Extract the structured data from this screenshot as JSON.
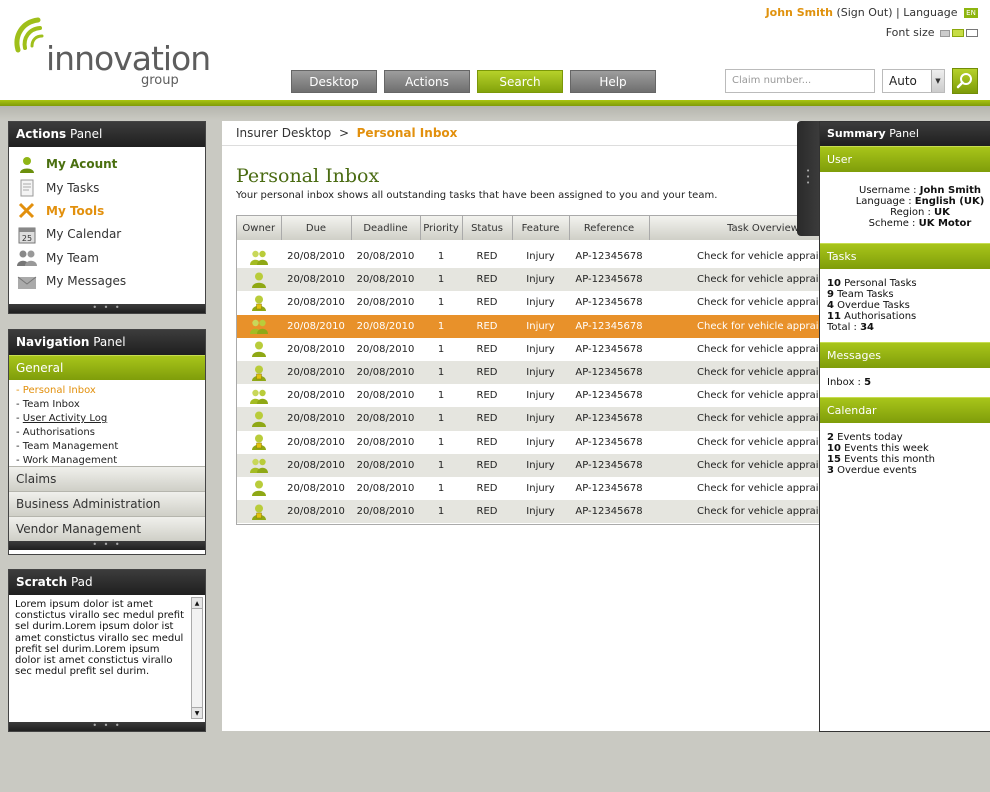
{
  "brand": {
    "name": "innovation",
    "sub": "group"
  },
  "userbar": {
    "username": "John Smith",
    "signout": "(Sign Out)",
    "sep": "|",
    "language_label": "Language",
    "lang_code": "EN",
    "font_size_label": "Font size"
  },
  "topnav": [
    {
      "label": "Desktop",
      "active": false
    },
    {
      "label": "Actions",
      "active": false
    },
    {
      "label": "Search",
      "active": true
    },
    {
      "label": "Help",
      "active": false
    }
  ],
  "search": {
    "placeholder": "Claim number...",
    "mode": "Auto"
  },
  "actions_panel": {
    "title_bold": "Actions",
    "title_rest": " Panel",
    "items": [
      {
        "label": "My Acount",
        "icon": "user-icon",
        "style": "hl"
      },
      {
        "label": "My Tasks",
        "icon": "document-icon",
        "style": ""
      },
      {
        "label": "My Tools",
        "icon": "tools-icon",
        "style": "hl2"
      },
      {
        "label": "My Calendar",
        "icon": "calendar-icon",
        "style": ""
      },
      {
        "label": "My Team",
        "icon": "team-icon",
        "style": ""
      },
      {
        "label": "My Messages",
        "icon": "envelope-icon",
        "style": ""
      }
    ],
    "calendar_day": "25"
  },
  "nav_panel": {
    "title_bold": "Navigation",
    "title_rest": " Panel",
    "general": "General",
    "sub_items": [
      {
        "label": "- Personal Inbox",
        "current": true
      },
      {
        "label": "- Team Inbox"
      },
      {
        "label": "User Activity Log",
        "underline": true
      },
      {
        "label": "- Authorisations"
      },
      {
        "label": "- Team Management"
      },
      {
        "label": "- Work Management"
      }
    ],
    "groups": [
      "Claims",
      "Business Administration",
      "Vendor Management"
    ]
  },
  "scratch_pad": {
    "title_bold": "Scratch",
    "title_rest": " Pad",
    "text": "Lorem ipsum dolor ist amet constictus virallo sec medul prefit sel durim.Lorem ipsum dolor ist amet constictus virallo sec medul prefit sel durim.Lorem ipsum dolor ist amet constictus virallo sec medul prefit sel durim."
  },
  "breadcrumb": {
    "parent": "Insurer Desktop",
    "sep": ">",
    "current": "Personal Inbox"
  },
  "page": {
    "title": "Personal Inbox",
    "description": "Your personal inbox shows all outstanding tasks that have been assigned to you and your team."
  },
  "table": {
    "headers": [
      "Owner",
      "Due",
      "Deadline",
      "Priority",
      "Status",
      "Feature",
      "Reference",
      "Task Overview"
    ],
    "rows": [
      {
        "owner": "team",
        "due": "20/08/2010",
        "deadline": "20/08/2010",
        "priority": "1",
        "status": "RED",
        "feature": "Injury",
        "reference": "AP-12345678",
        "overview": "Check for vehicle appraisal"
      },
      {
        "owner": "user",
        "due": "20/08/2010",
        "deadline": "20/08/2010",
        "priority": "1",
        "status": "RED",
        "feature": "Injury",
        "reference": "AP-12345678",
        "overview": "Check for vehicle appraisal"
      },
      {
        "owner": "lock",
        "due": "20/08/2010",
        "deadline": "20/08/2010",
        "priority": "1",
        "status": "RED",
        "feature": "Injury",
        "reference": "AP-12345678",
        "overview": "Check for vehicle appraisal"
      },
      {
        "owner": "team",
        "due": "20/08/2010",
        "deadline": "20/08/2010",
        "priority": "1",
        "status": "RED",
        "feature": "Injury",
        "reference": "AP-12345678",
        "overview": "Check for vehicle appraisal",
        "selected": true
      },
      {
        "owner": "user",
        "due": "20/08/2010",
        "deadline": "20/08/2010",
        "priority": "1",
        "status": "RED",
        "feature": "Injury",
        "reference": "AP-12345678",
        "overview": "Check for vehicle appraisal"
      },
      {
        "owner": "lock",
        "due": "20/08/2010",
        "deadline": "20/08/2010",
        "priority": "1",
        "status": "RED",
        "feature": "Injury",
        "reference": "AP-12345678",
        "overview": "Check for vehicle appraisal"
      },
      {
        "owner": "team",
        "due": "20/08/2010",
        "deadline": "20/08/2010",
        "priority": "1",
        "status": "RED",
        "feature": "Injury",
        "reference": "AP-12345678",
        "overview": "Check for vehicle appraisal"
      },
      {
        "owner": "user",
        "due": "20/08/2010",
        "deadline": "20/08/2010",
        "priority": "1",
        "status": "RED",
        "feature": "Injury",
        "reference": "AP-12345678",
        "overview": "Check for vehicle appraisal"
      },
      {
        "owner": "lock",
        "due": "20/08/2010",
        "deadline": "20/08/2010",
        "priority": "1",
        "status": "RED",
        "feature": "Injury",
        "reference": "AP-12345678",
        "overview": "Check for vehicle appraisal"
      },
      {
        "owner": "team",
        "due": "20/08/2010",
        "deadline": "20/08/2010",
        "priority": "1",
        "status": "RED",
        "feature": "Injury",
        "reference": "AP-12345678",
        "overview": "Check for vehicle appraisal"
      },
      {
        "owner": "user",
        "due": "20/08/2010",
        "deadline": "20/08/2010",
        "priority": "1",
        "status": "RED",
        "feature": "Injury",
        "reference": "AP-12345678",
        "overview": "Check for vehicle appraisal"
      },
      {
        "owner": "lock",
        "due": "20/08/2010",
        "deadline": "20/08/2010",
        "priority": "1",
        "status": "RED",
        "feature": "Injury",
        "reference": "AP-12345678",
        "overview": "Check for vehicle appraisal"
      }
    ]
  },
  "summary": {
    "title_bold": "Summary",
    "title_rest": " Panel",
    "user": {
      "heading": "User",
      "fields": [
        {
          "label": "Username : ",
          "value": "John Smith"
        },
        {
          "label": "Language : ",
          "value": "English (UK)"
        },
        {
          "label": "Region : ",
          "value": "UK"
        },
        {
          "label": "Scheme : ",
          "value": "UK Motor"
        }
      ]
    },
    "tasks": {
      "heading": "Tasks",
      "items": [
        {
          "num": "10",
          "text": " Personal Tasks"
        },
        {
          "num": "9",
          "text": " Team Tasks"
        },
        {
          "num": "4",
          "text": " Overdue Tasks"
        },
        {
          "num": "11",
          "text": " Authorisations"
        }
      ],
      "total_label": "Total : ",
      "total_value": "34"
    },
    "messages": {
      "heading": "Messages",
      "label": "Inbox : ",
      "value": "5"
    },
    "calendar": {
      "heading": "Calendar",
      "items": [
        {
          "num": "2",
          "text": " Events today"
        },
        {
          "num": "10",
          "text": " Events this week"
        },
        {
          "num": "15",
          "text": " Events this month"
        },
        {
          "num": "3",
          "text": " Overdue events"
        }
      ]
    }
  },
  "colors": {
    "brand_green": "#8db50f",
    "accent_orange": "#e2900d",
    "selected_row": "#e8912a"
  }
}
